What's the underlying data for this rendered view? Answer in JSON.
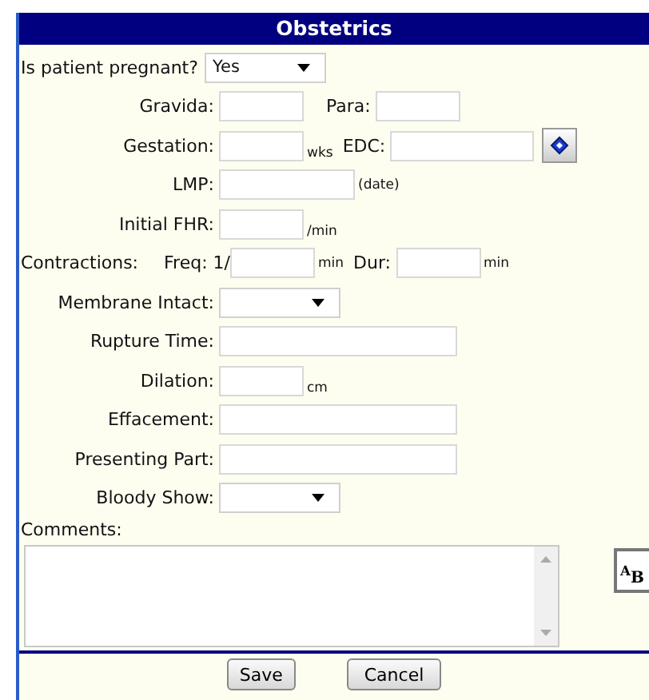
{
  "panel": {
    "title": "Obstetrics"
  },
  "rows": [
    {
      "kind": "select_left",
      "label": "Is patient pregnant?",
      "value": "Yes"
    },
    {
      "kind": "pair",
      "label": "Gravida:",
      "label2": "Para:"
    },
    {
      "kind": "gestation",
      "label": "Gestation:",
      "unit": "wks",
      "label2": "EDC:"
    },
    {
      "kind": "medium_unit",
      "label": "LMP:",
      "unit": "(date)"
    },
    {
      "kind": "short_unit",
      "label": "Initial FHR:",
      "unit": "/min"
    },
    {
      "kind": "contractions",
      "label": "Contractions:",
      "label2": "Freq: 1/",
      "unit": "min",
      "label3": "Dur:",
      "unit2": "min"
    },
    {
      "kind": "select",
      "label": "Membrane Intact:"
    },
    {
      "kind": "long",
      "label": "Rupture Time:"
    },
    {
      "kind": "short_unit",
      "label": "Dilation:",
      "unit": "cm"
    },
    {
      "kind": "long",
      "label": "Effacement:"
    },
    {
      "kind": "long",
      "label": "Presenting Part:"
    },
    {
      "kind": "select",
      "label": "Bloody Show:"
    }
  ],
  "comments": {
    "label": "Comments:",
    "spell_check": "$^{A}$B"
  },
  "buttons": [
    "Save",
    "Cancel"
  ]
}
